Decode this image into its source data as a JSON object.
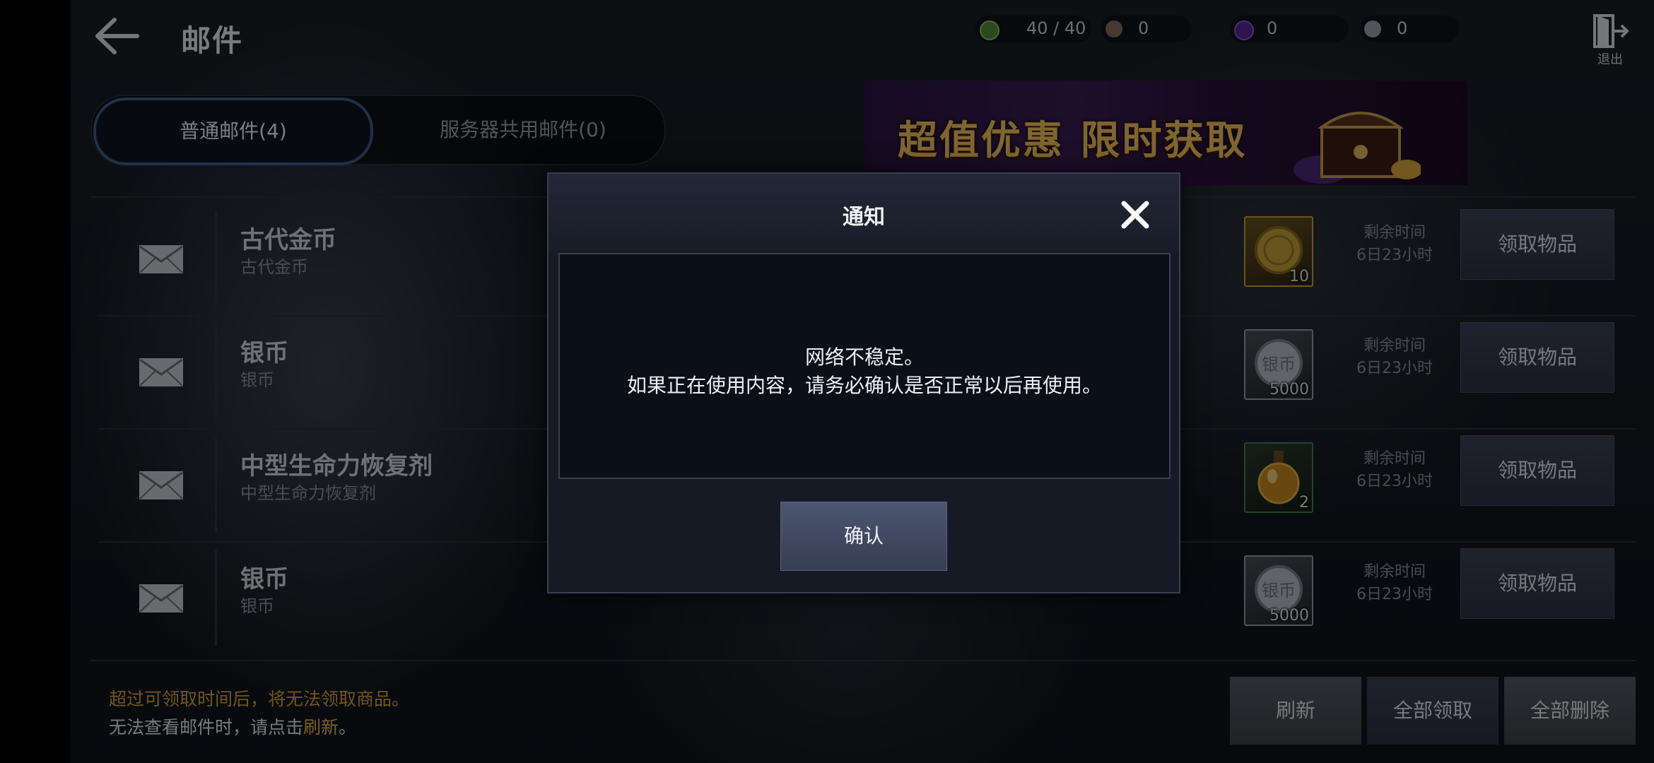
{
  "header": {
    "title": "邮件",
    "exit_label": "退出",
    "currencies": [
      {
        "name": "green-gem-icon",
        "value": "40 / 40",
        "color": "#4f8d3a"
      },
      {
        "name": "bronze-coin-icon",
        "value": "0",
        "color": "#8b6f5c"
      },
      {
        "name": "purple-gem-icon",
        "value": "0",
        "color": "#5a2a9a"
      },
      {
        "name": "silver-coin-icon",
        "value": "0",
        "color": "#9aa3ad"
      }
    ]
  },
  "tabs": {
    "normal": "普通邮件(4)",
    "server": "服务器共用邮件(0)"
  },
  "banner": {
    "text": "超值优惠 限时获取"
  },
  "mails": [
    {
      "title": "古代金币",
      "subtitle": "古代金币",
      "item": "ancient-gold-coin-icon",
      "qty": "10",
      "remain_label": "剩余时间",
      "remain_value": "6日23小时",
      "claim": "领取物品"
    },
    {
      "title": "银币",
      "subtitle": "银币",
      "item": "silver-coin-icon",
      "qty": "5000",
      "remain_label": "剩余时间",
      "remain_value": "6日23小时",
      "claim": "领取物品"
    },
    {
      "title": "中型生命力恢复剂",
      "subtitle": "中型生命力恢复剂",
      "item": "health-potion-icon",
      "qty": "2",
      "remain_label": "剩余时间",
      "remain_value": "6日23小时",
      "claim": "领取物品"
    },
    {
      "title": "银币",
      "subtitle": "银币",
      "item": "silver-coin-icon",
      "qty": "5000",
      "remain_label": "剩余时间",
      "remain_value": "6日23小时",
      "claim": "领取物品"
    }
  ],
  "footer": {
    "notice_line1": "超过可领取时间后，将无法领取商品。",
    "notice_line2_prefix": "无法查看邮件时，请点击",
    "notice_line2_link": "刷新",
    "notice_line2_suffix": "。",
    "refresh": "刷新",
    "claim_all": "全部领取",
    "delete_all": "全部删除"
  },
  "coin_glyph": "银币",
  "modal": {
    "title": "通知",
    "line1": "网络不稳定。",
    "line2": "如果正在使用内容，请务必确认是否正常以后再使用。",
    "confirm": "确认"
  }
}
